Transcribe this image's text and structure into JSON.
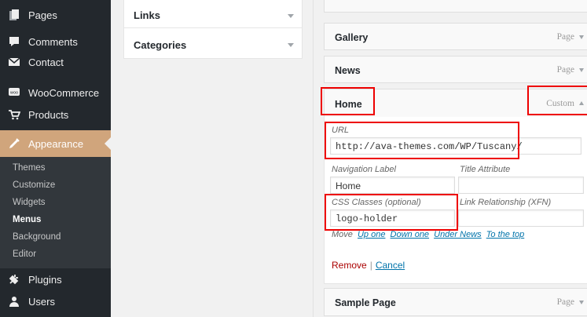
{
  "sidebar": {
    "items": [
      {
        "label": "Pages",
        "icon": "pages-icon"
      },
      {
        "label": "Comments",
        "icon": "comments-icon"
      },
      {
        "label": "Contact",
        "icon": "contact-icon"
      },
      {
        "label": "WooCommerce",
        "icon": "woocommerce-icon"
      },
      {
        "label": "Products",
        "icon": "products-icon"
      },
      {
        "label": "Appearance",
        "icon": "appearance-icon"
      },
      {
        "label": "Plugins",
        "icon": "plugins-icon"
      },
      {
        "label": "Users",
        "icon": "users-icon"
      }
    ],
    "submenu": [
      "Themes",
      "Customize",
      "Widgets",
      "Menus",
      "Background",
      "Editor"
    ]
  },
  "left_boxes": [
    {
      "title": "Links"
    },
    {
      "title": "Categories"
    }
  ],
  "menu_items": {
    "gallery": {
      "label": "Gallery",
      "type": "Page"
    },
    "news": {
      "label": "News",
      "type": "Page"
    },
    "home": {
      "label": "Home",
      "type": "Custom"
    },
    "sample": {
      "label": "Sample Page",
      "type": "Page"
    }
  },
  "settings": {
    "url_label": "URL",
    "url_value": "http://ava-themes.com/WP/Tuscany/",
    "nav_label_label": "Navigation Label",
    "nav_label_value": "Home",
    "title_attr_label": "Title Attribute",
    "title_attr_value": "",
    "css_label": "CSS Classes (optional)",
    "css_value": "logo-holder",
    "xfn_label": "Link Relationship (XFN)",
    "xfn_value": "",
    "move_label": "Move",
    "move_links": [
      "Up one",
      "Down one",
      "Under News",
      "To the top"
    ],
    "remove": "Remove",
    "separator": "|",
    "cancel": "Cancel"
  },
  "colors": {
    "sidebar_bg": "#23282d",
    "submenu_bg": "#32373c",
    "active_menu": "#d0a57c",
    "link": "#0073aa",
    "remove": "#aa0000",
    "highlight": "#ee0000"
  }
}
